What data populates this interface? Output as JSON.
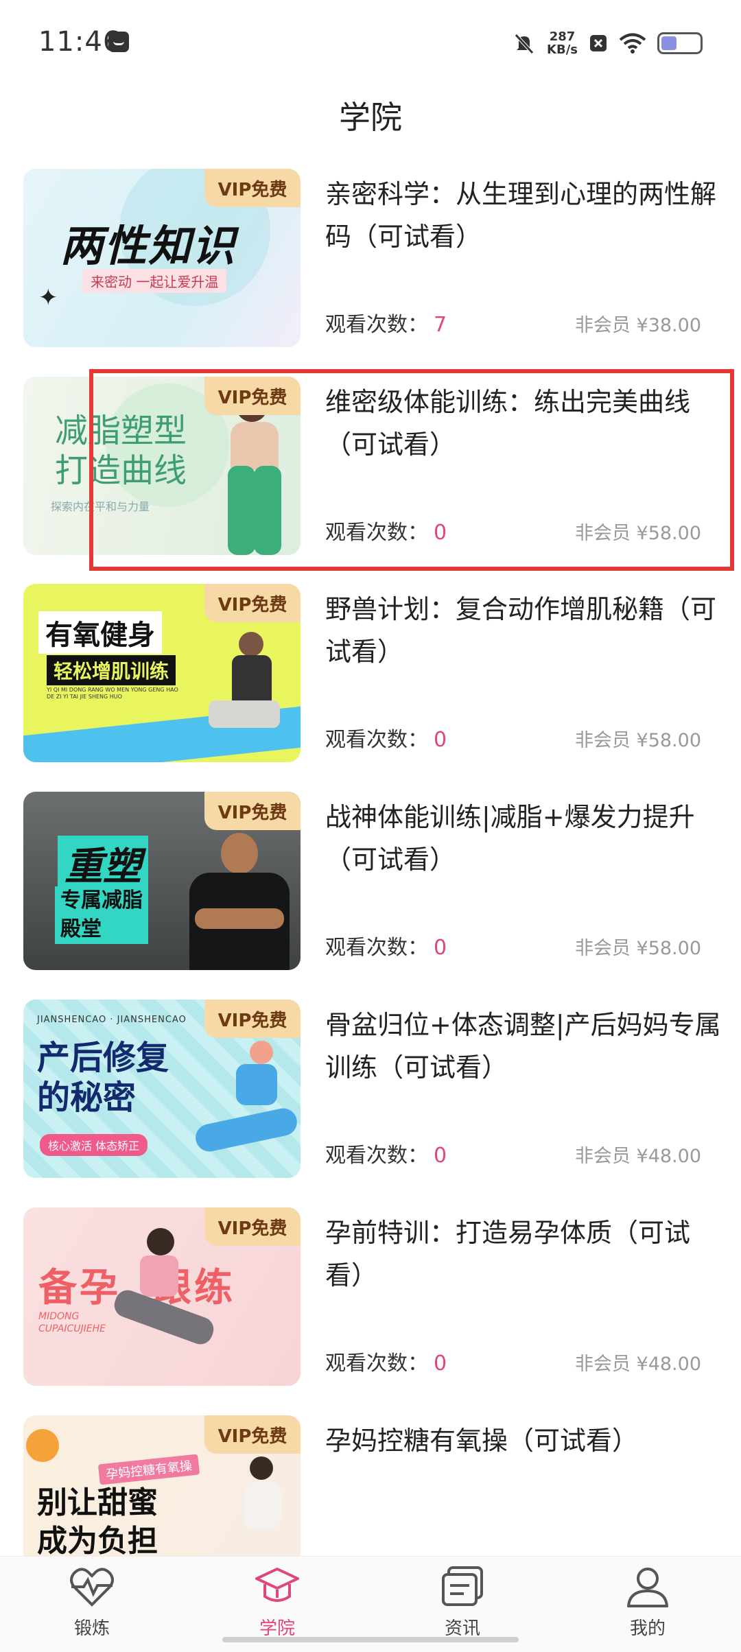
{
  "status_bar": {
    "time": "11:46",
    "net_speed_value": "287",
    "net_speed_unit": "KB/s"
  },
  "header": {
    "title": "学院"
  },
  "courses": [
    {
      "thumb_title": "两性知识",
      "thumb_subtitle": "来密动 一起让爱升温",
      "badge": "VIP免费",
      "title": "亲密科学：从生理到心理的两性解码（可试看）",
      "views_label": "观看次数：",
      "views": "7",
      "price": "非会员 ¥38.00"
    },
    {
      "thumb_title": "减脂塑型\n打造曲线",
      "thumb_subtitle": "探索内在平和与力量",
      "badge": "VIP免费",
      "title": "维密级体能训练：练出完美曲线（可试看）",
      "views_label": "观看次数：",
      "views": "0",
      "price": "非会员 ¥58.00"
    },
    {
      "thumb_title": "有氧健身",
      "thumb_subtitle": "轻松增肌训练",
      "thumb_small": "YI QI MI DONG RANG WO MEN YONG GENG HAO DE ZI YI TAI JIE SHENG HUO",
      "badge": "VIP免费",
      "title": "野兽计划：复合动作增肌秘籍（可试看）",
      "views_label": "观看次数：",
      "views": "0",
      "price": "非会员 ¥58.00"
    },
    {
      "thumb_title": "重塑",
      "thumb_subtitle": "专属减脂\n殿堂",
      "badge": "VIP免费",
      "title": "战神体能训练|减脂+爆发力提升（可试看）",
      "views_label": "观看次数：",
      "views": "0",
      "price": "非会员 ¥58.00"
    },
    {
      "thumb_small": "JIANSHENCAO · JIANSHENCAO",
      "thumb_title": "产后修复\n的秘密",
      "thumb_subtitle": "核心激活  体态矫正",
      "badge": "VIP免费",
      "title": "骨盆归位+体态调整|产后妈妈专属训练（可试看）",
      "views_label": "观看次数：",
      "views": "0",
      "price": "非会员 ¥48.00"
    },
    {
      "thumb_title": "备孕  跟练",
      "thumb_small": "MIDONG\nCUPAICUJIEHE",
      "badge": "VIP免费",
      "title": "孕前特训：打造易孕体质（可试看）",
      "views_label": "观看次数：",
      "views": "0",
      "price": "非会员 ¥48.00"
    },
    {
      "thumb_subtitle": "孕妈控糖有氧操",
      "thumb_title": "别让甜蜜\n成为负担",
      "badge": "VIP免费",
      "title": "孕妈控糖有氧操（可试看）"
    }
  ],
  "bottom_nav": [
    {
      "label": "锻炼",
      "icon": "heart-pulse-icon",
      "active": false
    },
    {
      "label": "学院",
      "icon": "graduation-cap-icon",
      "active": true
    },
    {
      "label": "资讯",
      "icon": "news-icon",
      "active": false
    },
    {
      "label": "我的",
      "icon": "user-icon",
      "active": false
    }
  ],
  "colors": {
    "accent": "#e0457b",
    "vip_bg": "#f6d9a6",
    "highlight": "#e53935"
  }
}
